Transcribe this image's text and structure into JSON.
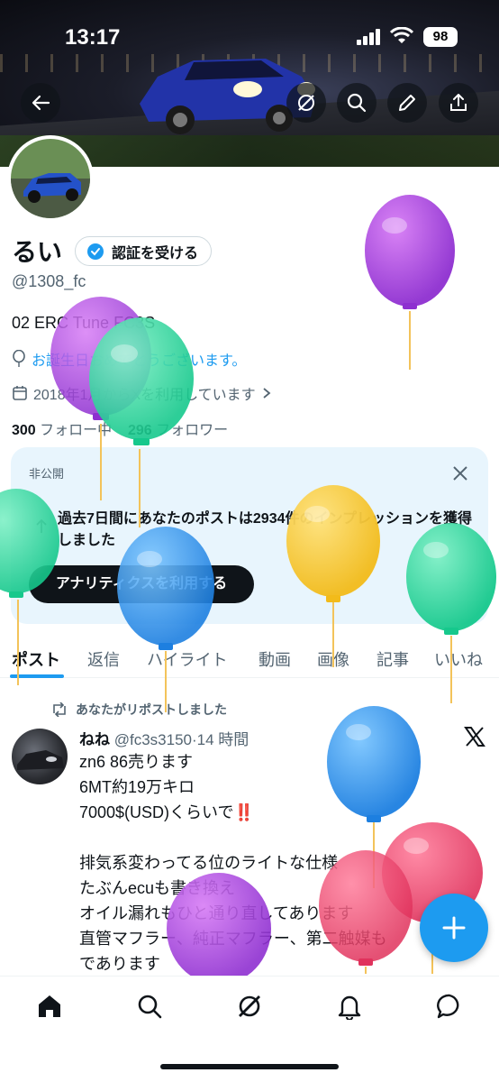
{
  "status_bar": {
    "time": "13:17",
    "battery": "98"
  },
  "header_buttons": [
    {
      "icon": "back-arrow-icon"
    },
    {
      "icon": "grok-icon"
    },
    {
      "icon": "search-icon"
    },
    {
      "icon": "edit-pencil-icon"
    },
    {
      "icon": "share-icon"
    }
  ],
  "profile": {
    "name": "るい",
    "verify_label": "認証を受ける",
    "handle": "@1308_fc",
    "bio": "02 ERC Tune FC3S",
    "birthday": "お誕生日おめでとうございます。",
    "joined": "2018年1月からXを利用しています",
    "following_count": "300",
    "following_label": "フォロー中",
    "followers_count": "296",
    "followers_label": "フォロワー"
  },
  "private_card": {
    "label": "非公開",
    "message": "過去7日間にあなたのポストは2934件のインプレッションを獲得しました",
    "button": "アナリティクスを利用する"
  },
  "tabs": [
    "ポスト",
    "返信",
    "ハイライト",
    "動画",
    "画像",
    "記事",
    "いいね"
  ],
  "post": {
    "repost_label": "あなたがリポストしました",
    "author": "ねね",
    "handle": "@fc3s3150",
    "time": "14 時間",
    "text": "zn6 86売ります\n6MT約19万キロ\n7000$(USD)くらいで‼️\n\n排気系変わってる位のライトな仕様\nたぶんecuも書き換え\nオイル漏れもひと通り直してあります\n直管マフラー、純正マフラー、第二触媒も\nであります"
  },
  "colors": {
    "accent": "#1d9bf0",
    "text": "#0f1419",
    "muted": "#536471",
    "card_bg": "#e8f5fd"
  },
  "bottom_nav": [
    "home-icon",
    "search-icon",
    "grok-icon",
    "notifications-bell-icon",
    "messages-icon"
  ]
}
